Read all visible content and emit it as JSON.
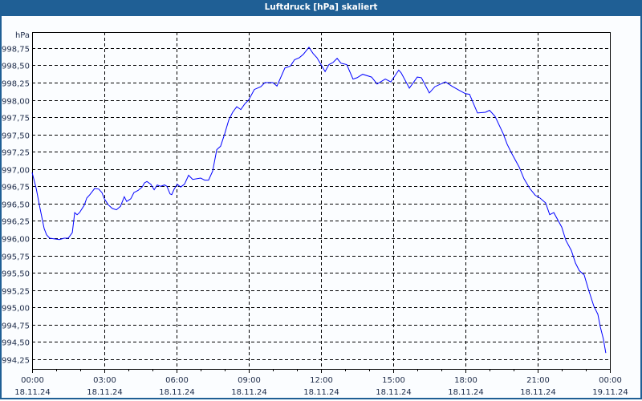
{
  "window": {
    "title": "Luftdruck [hPa] skaliert"
  },
  "chart_data": {
    "type": "line",
    "title": "Luftdruck [hPa] skaliert",
    "ylabel": "hPa",
    "xlabel": "",
    "xlim": [
      0,
      24
    ],
    "ylim": [
      994.11,
      998.98
    ],
    "grid": true,
    "line_color": "#0000ff",
    "y_ticks": [
      {
        "value": 994.25,
        "label": "994,25"
      },
      {
        "value": 994.5,
        "label": "994,50"
      },
      {
        "value": 994.75,
        "label": "994,75"
      },
      {
        "value": 995.0,
        "label": "995,00"
      },
      {
        "value": 995.25,
        "label": "995,25"
      },
      {
        "value": 995.5,
        "label": "995,50"
      },
      {
        "value": 995.75,
        "label": "995,75"
      },
      {
        "value": 996.0,
        "label": "996,00"
      },
      {
        "value": 996.25,
        "label": "996,25"
      },
      {
        "value": 996.5,
        "label": "996,50"
      },
      {
        "value": 996.75,
        "label": "996,75"
      },
      {
        "value": 997.0,
        "label": "997,00"
      },
      {
        "value": 997.25,
        "label": "997,25"
      },
      {
        "value": 997.5,
        "label": "997,50"
      },
      {
        "value": 997.75,
        "label": "997,75"
      },
      {
        "value": 998.0,
        "label": "998,00"
      },
      {
        "value": 998.25,
        "label": "998,25"
      },
      {
        "value": 998.5,
        "label": "998,50"
      },
      {
        "value": 998.75,
        "label": "998,75"
      }
    ],
    "x_ticks": [
      {
        "value": 0,
        "time": "00:00",
        "date": "18.11.24"
      },
      {
        "value": 3,
        "time": "03:00",
        "date": "18.11.24"
      },
      {
        "value": 6,
        "time": "06:00",
        "date": "18.11.24"
      },
      {
        "value": 9,
        "time": "09:00",
        "date": "18.11.24"
      },
      {
        "value": 12,
        "time": "12:00",
        "date": "18.11.24"
      },
      {
        "value": 15,
        "time": "15:00",
        "date": "18.11.24"
      },
      {
        "value": 18,
        "time": "18:00",
        "date": "18.11.24"
      },
      {
        "value": 21,
        "time": "21:00",
        "date": "18.11.24"
      },
      {
        "value": 24,
        "time": "00:00",
        "date": "19.11.24"
      }
    ],
    "series": [
      {
        "name": "Luftdruck",
        "x": [
          0,
          0.17,
          0.33,
          0.5,
          0.6,
          0.73,
          0.93,
          1.13,
          1.33,
          1.5,
          1.67,
          1.77,
          1.87,
          1.97,
          2.17,
          2.27,
          2.4,
          2.6,
          2.77,
          2.9,
          3,
          3.17,
          3.33,
          3.5,
          3.67,
          3.83,
          3.93,
          4.1,
          4.23,
          4.4,
          4.57,
          4.67,
          4.77,
          4.93,
          5.07,
          5.2,
          5.33,
          5.5,
          5.6,
          5.73,
          5.8,
          5.9,
          6.03,
          6.17,
          6.33,
          6.5,
          6.67,
          7,
          7.17,
          7.33,
          7.5,
          7.67,
          7.83,
          8,
          8.17,
          8.33,
          8.5,
          8.67,
          8.83,
          9,
          9.23,
          9.5,
          9.67,
          10,
          10.17,
          10.5,
          10.73,
          10.9,
          11.1,
          11.27,
          11.5,
          11.67,
          11.83,
          12.17,
          12.33,
          12.5,
          12.67,
          12.83,
          13.07,
          13.33,
          13.5,
          13.73,
          14.1,
          14.33,
          14.67,
          14.9,
          15.23,
          15.33,
          15.67,
          16,
          16.17,
          16.5,
          16.73,
          17.17,
          17.43,
          17.73,
          18,
          18.17,
          18.5,
          18.83,
          19,
          19.23,
          19.57,
          19.73,
          19.93,
          20.23,
          20.43,
          20.67,
          20.9,
          21.1,
          21.33,
          21.5,
          21.67,
          22,
          22.17,
          22.4,
          22.57,
          22.73,
          22.93,
          23.1,
          23.33,
          23.5,
          23.6,
          23.73,
          23.83
        ],
        "y": [
          996.95,
          996.72,
          996.43,
          996.14,
          996.05,
          996.0,
          995.99,
          995.98,
          996.0,
          996.0,
          996.08,
          996.37,
          996.34,
          996.37,
          996.48,
          996.58,
          996.63,
          996.72,
          996.71,
          996.66,
          996.57,
          996.48,
          996.43,
          996.41,
          996.46,
          996.6,
          996.53,
          996.57,
          996.66,
          996.69,
          996.74,
          996.8,
          996.82,
          996.78,
          996.7,
          996.77,
          996.75,
          996.77,
          996.75,
          996.64,
          996.63,
          996.71,
          996.78,
          996.74,
          996.78,
          996.91,
          996.85,
          996.87,
          996.84,
          996.84,
          996.97,
          997.28,
          997.33,
          997.51,
          997.71,
          997.82,
          997.9,
          997.86,
          997.94,
          998.0,
          998.15,
          998.19,
          998.25,
          998.25,
          998.2,
          998.46,
          998.49,
          998.58,
          998.61,
          998.66,
          998.76,
          998.67,
          998.61,
          998.41,
          998.51,
          998.54,
          998.6,
          998.53,
          998.51,
          998.3,
          998.32,
          998.37,
          998.33,
          998.23,
          998.3,
          998.26,
          998.43,
          998.39,
          998.17,
          998.33,
          998.32,
          998.1,
          998.19,
          998.26,
          998.2,
          998.14,
          998.09,
          998.08,
          997.81,
          997.82,
          997.85,
          997.76,
          997.51,
          997.36,
          997.22,
          997.03,
          996.86,
          996.72,
          996.62,
          996.58,
          996.51,
          996.34,
          996.37,
          996.16,
          995.97,
          995.82,
          995.64,
          995.53,
          995.47,
          995.27,
          995.02,
          994.9,
          994.72,
          994.54,
          994.34
        ]
      }
    ]
  }
}
